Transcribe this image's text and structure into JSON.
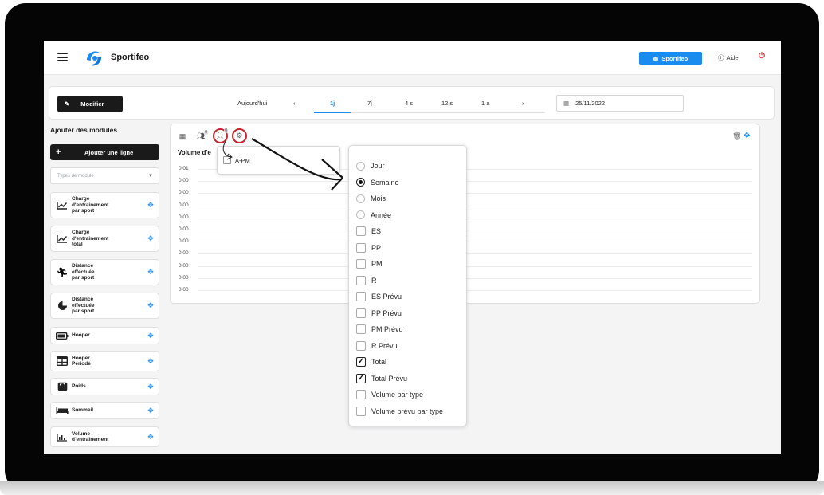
{
  "header": {
    "app_name": "Sportifeo",
    "sportifeo_button": "Sportifeo",
    "help_label": "Aide"
  },
  "toolbar": {
    "edit_label": "Modifier",
    "today_label": "Aujourd'hui",
    "periods": [
      "1j",
      "7j",
      "4 s",
      "12 s",
      "1 a"
    ],
    "selected_period": "1j",
    "date_value": "25/11/2022"
  },
  "sidebar": {
    "title": "Ajouter des modules",
    "add_line_label": "Ajouter une ligne",
    "module_type_placeholder": "Types de module",
    "modules": [
      {
        "label": "Charge\nd'entrainement\npar sport",
        "icon": "line-chart-icon"
      },
      {
        "label": "Charge\nd'entrainement\ntotal",
        "icon": "line-chart-icon"
      },
      {
        "label": "Distance\neffectuée\npar sport",
        "icon": "runner-icon"
      },
      {
        "label": "Distance\neffectuée\npar sport",
        "icon": "pie-chart-icon"
      },
      {
        "label": "Hooper",
        "icon": "battery-icon"
      },
      {
        "label": "Hooper\nPeriode",
        "icon": "table-icon"
      },
      {
        "label": "Poids",
        "icon": "scale-icon"
      },
      {
        "label": "Sommeil",
        "icon": "bed-icon"
      },
      {
        "label": "Volume\nd'entrainement",
        "icon": "bar-chart-icon"
      }
    ]
  },
  "widget": {
    "title": "Volume d'e",
    "team_badge": "0",
    "athlete_badge": "0",
    "rows": [
      "0:01",
      "0:00",
      "0:00",
      "0:00",
      "0:00",
      "0:00",
      "0:00",
      "0:00",
      "0:00",
      "0:00",
      "0:00"
    ]
  },
  "athlete_popup": {
    "item": "A-PM"
  },
  "settings_popup": {
    "options": [
      {
        "label": "Jour",
        "kind": "radio",
        "checked": false
      },
      {
        "label": "Semaine",
        "kind": "radio",
        "checked": true
      },
      {
        "label": "Mois",
        "kind": "radio",
        "checked": false
      },
      {
        "label": "Année",
        "kind": "radio",
        "checked": false
      },
      {
        "label": "ES",
        "kind": "check",
        "checked": false
      },
      {
        "label": "PP",
        "kind": "check",
        "checked": false
      },
      {
        "label": "PM",
        "kind": "check",
        "checked": false
      },
      {
        "label": "R",
        "kind": "check",
        "checked": false
      },
      {
        "label": "ES Prévu",
        "kind": "check",
        "checked": false
      },
      {
        "label": "PP Prévu",
        "kind": "check",
        "checked": false
      },
      {
        "label": "PM Prévu",
        "kind": "check",
        "checked": false
      },
      {
        "label": "R Prévu",
        "kind": "check",
        "checked": false
      },
      {
        "label": "Total",
        "kind": "check",
        "checked": true
      },
      {
        "label": "Total Prévu",
        "kind": "check",
        "checked": true
      },
      {
        "label": "Volume par type",
        "kind": "check",
        "checked": false
      },
      {
        "label": "Volume prévu par type",
        "kind": "check",
        "checked": false
      }
    ]
  },
  "colors": {
    "accent": "#1a8cf0",
    "highlight_ring": "#c0262d",
    "dark_button": "#1a1a1a"
  }
}
